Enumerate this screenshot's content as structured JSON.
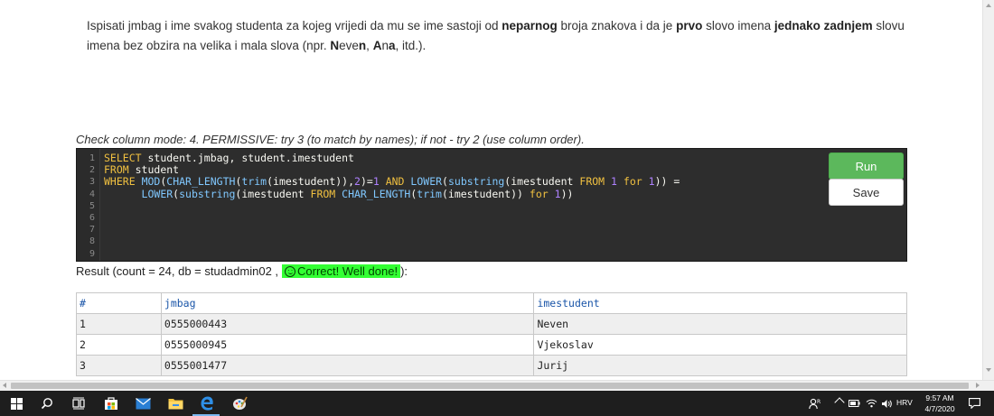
{
  "task": {
    "segments": [
      {
        "text": "Ispisati jmbag i ime svakog studenta za kojeg vrijedi da mu se ime sastoji od ",
        "bold": false
      },
      {
        "text": "neparnog",
        "bold": true
      },
      {
        "text": " broja znakova i da je ",
        "bold": false
      },
      {
        "text": "prvo",
        "bold": true
      },
      {
        "text": " slovo imena ",
        "bold": false
      },
      {
        "text": "jednako zadnjem",
        "bold": true
      },
      {
        "text": " slovu imena bez obzira na velika i mala slova (npr. ",
        "bold": false
      },
      {
        "text": "N",
        "bold": true
      },
      {
        "text": "eve",
        "bold": false
      },
      {
        "text": "n",
        "bold": true
      },
      {
        "text": ", ",
        "bold": false
      },
      {
        "text": "A",
        "bold": true
      },
      {
        "text": "n",
        "bold": false
      },
      {
        "text": "a",
        "bold": true
      },
      {
        "text": ", itd.).",
        "bold": false
      }
    ]
  },
  "mode_line": "Check column mode: 4. PERMISSIVE: try 3 (to match by names); if not - try 2 (use column order).",
  "editor": {
    "line_numbers": [
      "1",
      "2",
      "3",
      "4",
      "5",
      "6",
      "7",
      "8",
      "9"
    ],
    "lines": [
      [
        {
          "t": "SELECT",
          "c": "kw"
        },
        {
          "t": " student.jmbag, student.imestudent",
          "c": "plain"
        }
      ],
      [
        {
          "t": "FROM",
          "c": "kw"
        },
        {
          "t": " student",
          "c": "plain"
        }
      ],
      [
        {
          "t": "WHERE",
          "c": "kw"
        },
        {
          "t": " ",
          "c": "plain"
        },
        {
          "t": "MOD",
          "c": "fn"
        },
        {
          "t": "(",
          "c": "plain"
        },
        {
          "t": "CHAR_LENGTH",
          "c": "fn"
        },
        {
          "t": "(",
          "c": "plain"
        },
        {
          "t": "trim",
          "c": "fn"
        },
        {
          "t": "(imestudent)),",
          "c": "plain"
        },
        {
          "t": "2",
          "c": "num"
        },
        {
          "t": ")=",
          "c": "plain"
        },
        {
          "t": "1",
          "c": "num"
        },
        {
          "t": " ",
          "c": "plain"
        },
        {
          "t": "AND",
          "c": "kw"
        },
        {
          "t": " ",
          "c": "plain"
        },
        {
          "t": "LOWER",
          "c": "fn"
        },
        {
          "t": "(",
          "c": "plain"
        },
        {
          "t": "substring",
          "c": "fn"
        },
        {
          "t": "(imestudent ",
          "c": "plain"
        },
        {
          "t": "FROM",
          "c": "kw"
        },
        {
          "t": " ",
          "c": "plain"
        },
        {
          "t": "1",
          "c": "num"
        },
        {
          "t": " ",
          "c": "plain"
        },
        {
          "t": "for",
          "c": "kw"
        },
        {
          "t": " ",
          "c": "plain"
        },
        {
          "t": "1",
          "c": "num"
        },
        {
          "t": ")) =",
          "c": "plain"
        }
      ],
      [
        {
          "t": "      ",
          "c": "plain"
        },
        {
          "t": "LOWER",
          "c": "fn"
        },
        {
          "t": "(",
          "c": "plain"
        },
        {
          "t": "substring",
          "c": "fn"
        },
        {
          "t": "(imestudent ",
          "c": "plain"
        },
        {
          "t": "FROM",
          "c": "kw"
        },
        {
          "t": " ",
          "c": "plain"
        },
        {
          "t": "CHAR_LENGTH",
          "c": "fn"
        },
        {
          "t": "(",
          "c": "plain"
        },
        {
          "t": "trim",
          "c": "fn"
        },
        {
          "t": "(imestudent)) ",
          "c": "plain"
        },
        {
          "t": "for",
          "c": "kw"
        },
        {
          "t": " ",
          "c": "plain"
        },
        {
          "t": "1",
          "c": "num"
        },
        {
          "t": "))",
          "c": "plain"
        }
      ],
      [],
      [],
      [],
      [],
      []
    ]
  },
  "buttons": {
    "run_label": "Run",
    "save_label": "Save"
  },
  "result": {
    "prefix": "Result (count = 24, db = studadmin02 ,",
    "correct_text": "Correct! Well done!",
    "suffix": "):"
  },
  "table": {
    "headers": [
      "#",
      "jmbag",
      "imestudent"
    ],
    "rows": [
      [
        "1",
        "0555000443",
        "Neven"
      ],
      [
        "2",
        "0555000945",
        "Vjekoslav"
      ],
      [
        "3",
        "0555001477",
        "Jurij"
      ]
    ]
  },
  "taskbar": {
    "icons": [
      "windows-start-icon",
      "search-icon",
      "task-view-icon",
      "store-icon",
      "mail-icon",
      "file-explorer-icon",
      "edge-icon",
      "paint-icon"
    ],
    "language": "HRV",
    "time": "9:57 AM",
    "date": "4/7/2020"
  },
  "colors": {
    "run_button": "#5cb85c",
    "correct_badge": "#33ff33",
    "editor_bg": "#2d2d2d",
    "header_text": "#1a55a8"
  }
}
